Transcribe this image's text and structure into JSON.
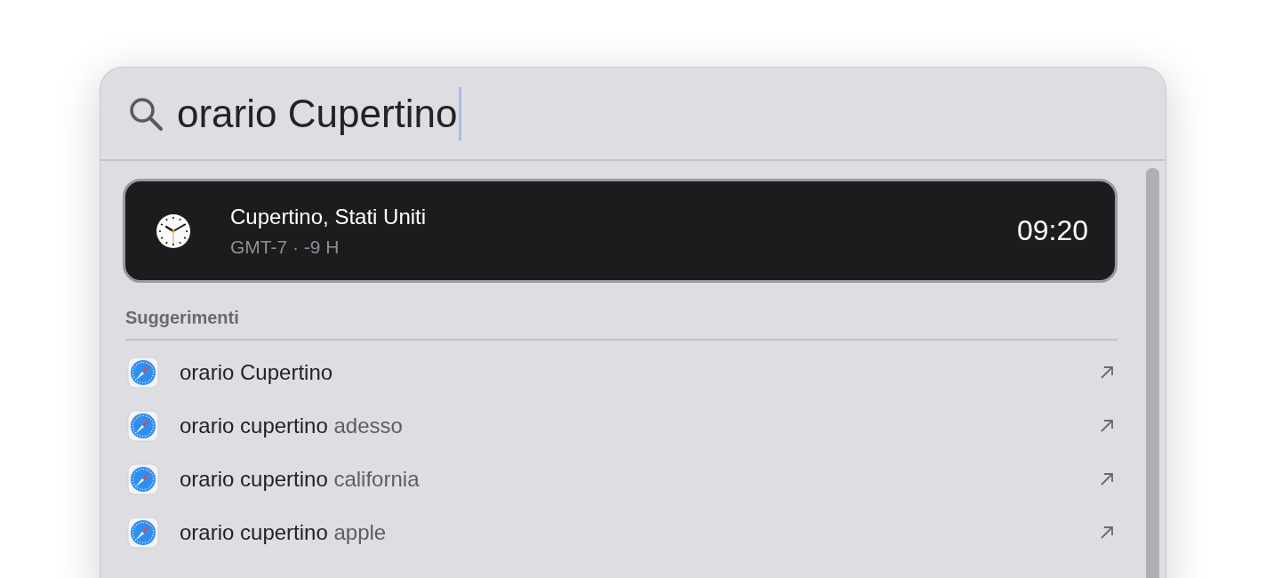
{
  "search": {
    "value": "orario Cupertino"
  },
  "top_result": {
    "title": "Cupertino, Stati Uniti",
    "subtitle": "GMT-7 · -9 H",
    "time": "09:20",
    "selected": true
  },
  "suggestions": {
    "heading": "Suggerimenti",
    "items": [
      {
        "query": "orario Cupertino",
        "selected": false
      },
      {
        "query": "orario cupertino",
        "completion": "adesso",
        "selected": false
      },
      {
        "query": "orario cupertino",
        "completion": "california",
        "selected": false
      },
      {
        "query": "orario cupertino",
        "completion": "apple",
        "selected": false
      }
    ]
  }
}
